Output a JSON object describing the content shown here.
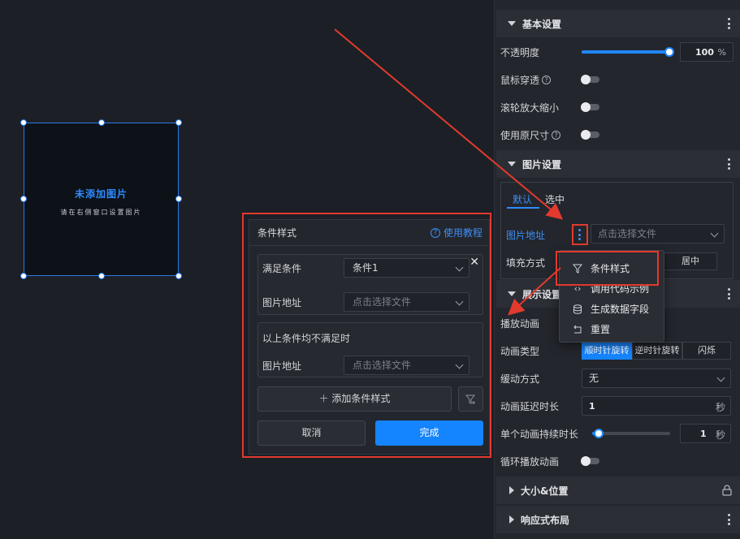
{
  "widget": {
    "title": "未添加图片",
    "subtitle": "请在右侧窗口设置图片"
  },
  "dialog": {
    "title": "条件样式",
    "help_label": "使用教程",
    "help_icon": "help-circle-icon",
    "condition_label": "满足条件",
    "condition_value": "条件1",
    "image_label": "图片地址",
    "image_placeholder": "点击选择文件",
    "else_title": "以上条件均不满足时",
    "else_image_label": "图片地址",
    "else_image_placeholder": "点击选择文件",
    "add_label": "添加条件样式",
    "cancel_label": "取消",
    "done_label": "完成"
  },
  "panel": {
    "basic": {
      "title": "基本设置",
      "opacity_label": "不透明度",
      "opacity_value": "100",
      "opacity_unit": "%",
      "opacity_fraction": 1.0,
      "mouse_through_label": "鼠标穿透",
      "scroll_zoom_label": "滚轮放大缩小",
      "original_size_label": "使用原尺寸"
    },
    "image": {
      "title": "图片设置",
      "tab_default": "默认",
      "tab_selected": "选中",
      "url_label": "图片地址",
      "url_placeholder": "点击选择文件",
      "fill_label": "填充方式",
      "fill_option_center": "居中"
    },
    "display": {
      "title": "展示设置",
      "play_anim_label": "播放动画",
      "anim_type_label": "动画类型",
      "anim_types": [
        "顺时针旋转",
        "逆时针旋转",
        "闪烁"
      ],
      "easing_label": "缓动方式",
      "easing_value": "无",
      "delay_label": "动画延迟时长",
      "delay_value": "1",
      "delay_unit": "秒",
      "duration_label": "单个动画持续时长",
      "duration_value": "1",
      "duration_unit": "秒",
      "loop_label": "循环播放动画"
    },
    "size": {
      "title": "大小&位置"
    },
    "responsive": {
      "title": "响应式布局"
    }
  },
  "menu": {
    "items": [
      {
        "label": "条件样式",
        "icon": "filter-icon"
      },
      {
        "label": "调用代码示例",
        "icon": "code-icon"
      },
      {
        "label": "生成数据字段",
        "icon": "database-icon"
      },
      {
        "label": "重置",
        "icon": "reset-icon"
      }
    ]
  },
  "colors": {
    "accent": "#1584ff",
    "annotation": "#e23a2e",
    "selection": "#2a7be8"
  }
}
